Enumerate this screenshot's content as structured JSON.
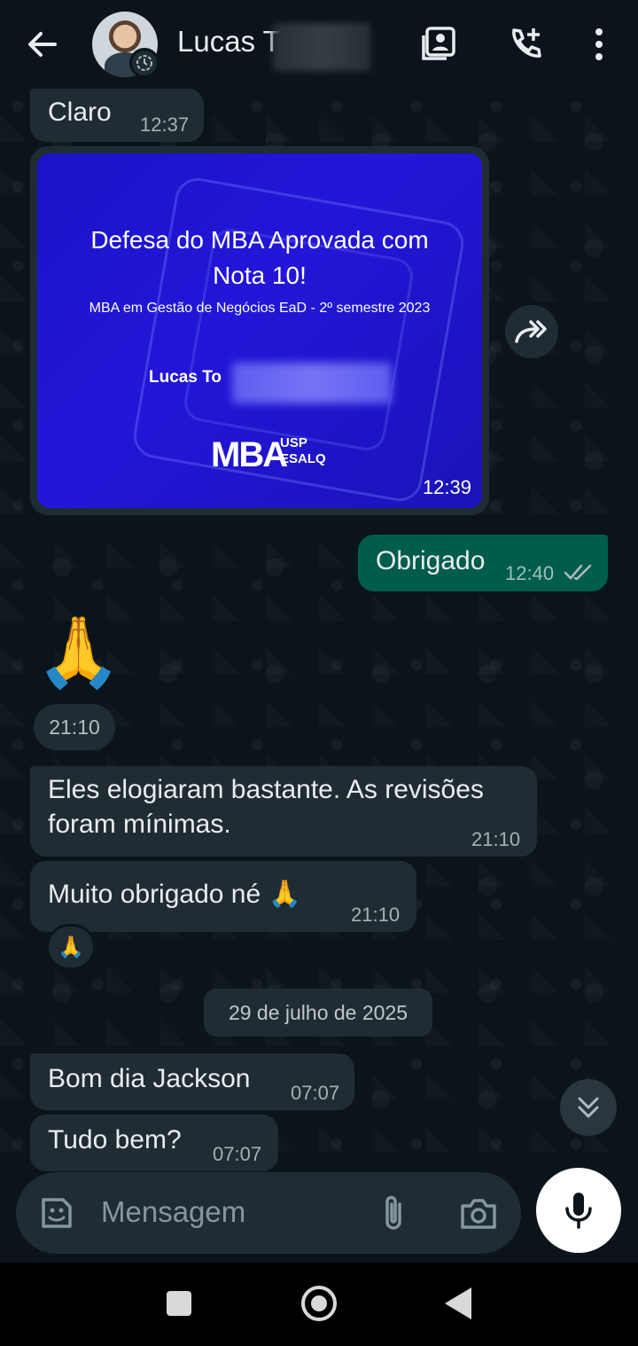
{
  "header": {
    "contact_name": "Lucas T",
    "icons": [
      "back-arrow-icon",
      "avatar",
      "status-icon",
      "contact-card-icon",
      "add-call-icon",
      "more-vert-icon"
    ]
  },
  "messages": [
    {
      "id": "m1",
      "dir": "in",
      "text": "Claro",
      "time": "12:37"
    },
    {
      "id": "m2",
      "dir": "in",
      "type": "image",
      "time": "12:39",
      "image": {
        "title_line1": "Defesa do MBA Aprovada com",
        "title_line2": "Nota 10!",
        "subtitle": "MBA em Gestão de Negócios EaD - 2º semestre 2023",
        "name_text": "Lucas To",
        "logo_main": "MBA",
        "logo_sub_1": "USP",
        "logo_sub_2": "ESALQ"
      }
    },
    {
      "id": "m3",
      "dir": "out",
      "text": "Obrigado",
      "time": "12:40",
      "status": "read"
    },
    {
      "id": "m4",
      "dir": "in",
      "type": "emoji",
      "text": "🙏",
      "time": "21:10"
    },
    {
      "id": "m5",
      "dir": "in",
      "text_line1": "Eles elogiaram bastante. As revisões",
      "text_line2": "foram mínimas.",
      "time": "21:10"
    },
    {
      "id": "m6",
      "dir": "in",
      "text": "Muito obrigado né 🙏",
      "time": "21:10",
      "reaction": "🙏"
    },
    {
      "id": "m7",
      "dir": "in",
      "text": "Bom dia Jackson",
      "time": "07:07"
    },
    {
      "id": "m8",
      "dir": "in",
      "text": "Tudo bem?",
      "time": "07:07"
    }
  ],
  "date_separator": "29 de julho de 2025",
  "composer": {
    "placeholder": "Mensagem"
  },
  "colors": {
    "background": "#0b141a",
    "incoming": "#202c33",
    "outgoing": "#005c4b",
    "image_blue": "#2316d8"
  }
}
